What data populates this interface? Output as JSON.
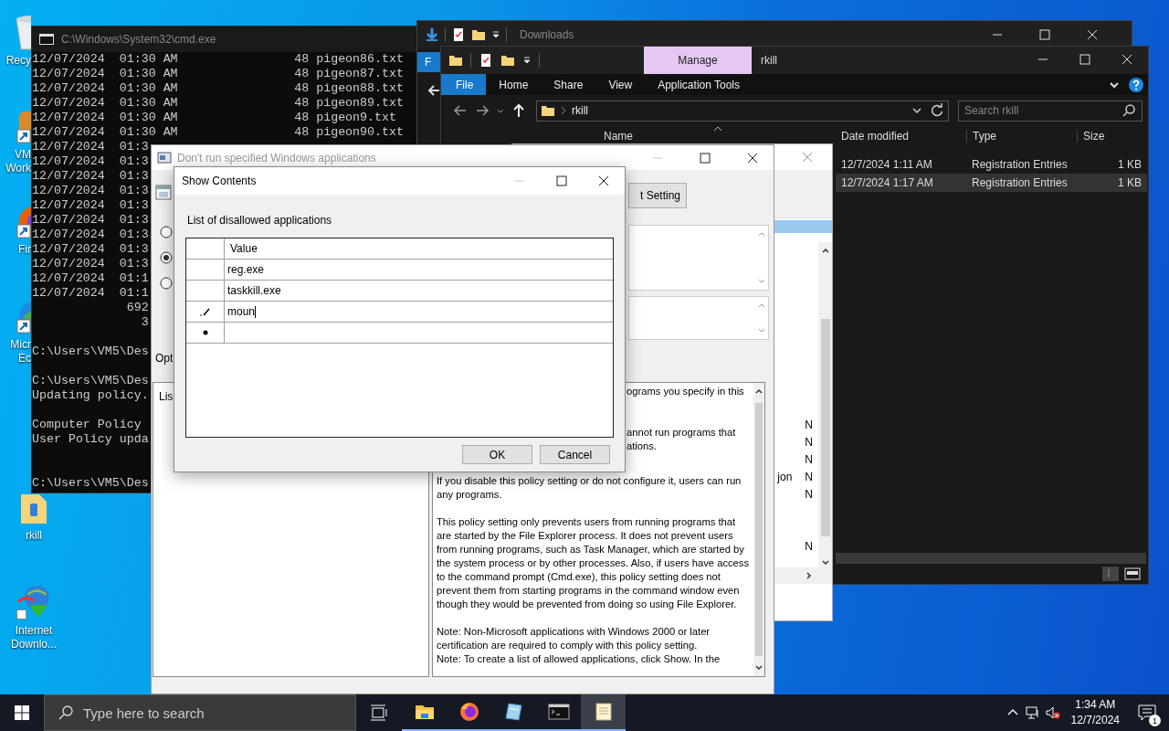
{
  "desktop": {
    "icons": [
      {
        "kind": "recycle-bin",
        "label": "Recy"
      },
      {
        "kind": "app-shortcut",
        "label": "VM Work"
      },
      {
        "kind": "firefox",
        "label": "Fir"
      },
      {
        "kind": "edge",
        "label": "Micr Ec"
      },
      {
        "kind": "folder",
        "label": "rkill"
      },
      {
        "kind": "download-manager",
        "label": "Internet Downlo..."
      }
    ]
  },
  "cmd": {
    "title": "C:\\Windows\\System32\\cmd.exe",
    "lines": [
      {
        "kind": "text",
        "text": "12/07/2024  01:30 AM                48 pigeon86.txt"
      },
      {
        "kind": "text",
        "text": "12/07/2024  01:30 AM                48 pigeon87.txt"
      },
      {
        "kind": "text",
        "text": "12/07/2024  01:30 AM                48 pigeon88.txt"
      },
      {
        "kind": "text",
        "text": "12/07/2024  01:30 AM                48 pigeon89.txt"
      },
      {
        "kind": "text",
        "text": "12/07/2024  01:30 AM                48 pigeon9.txt"
      },
      {
        "kind": "text",
        "text": "12/07/2024  01:30 AM                48 pigeon90.txt"
      },
      {
        "kind": "text",
        "text": "12/07/2024  01:3"
      },
      {
        "kind": "text",
        "text": "12/07/2024  01:3"
      },
      {
        "kind": "text",
        "text": "12/07/2024  01:3"
      },
      {
        "kind": "text",
        "text": "12/07/2024  01:3"
      },
      {
        "kind": "text",
        "text": "12/07/2024  01:3"
      },
      {
        "kind": "text",
        "text": "12/07/2024  01:3"
      },
      {
        "kind": "text",
        "text": "12/07/2024  01:3"
      },
      {
        "kind": "text",
        "text": "12/07/2024  01:3"
      },
      {
        "kind": "text",
        "text": "12/07/2024  01:3"
      },
      {
        "kind": "text",
        "text": "12/07/2024  01:1"
      },
      {
        "kind": "text",
        "text": "12/07/2024  01:1"
      },
      {
        "kind": "text",
        "text": "             692"
      },
      {
        "kind": "text",
        "text": "               3"
      },
      {
        "kind": "blank"
      },
      {
        "kind": "text",
        "text": "C:\\Users\\VM5\\Des"
      },
      {
        "kind": "blank"
      },
      {
        "kind": "text",
        "text": "C:\\Users\\VM5\\Des"
      },
      {
        "kind": "text",
        "text": "Updating policy."
      },
      {
        "kind": "blank"
      },
      {
        "kind": "text",
        "text": "Computer Policy"
      },
      {
        "kind": "text",
        "text": "User Policy upda"
      },
      {
        "kind": "blank"
      },
      {
        "kind": "blank"
      },
      {
        "kind": "text",
        "text": "C:\\Users\\VM5\\Des"
      }
    ]
  },
  "downloads_window": {
    "title": "Downloads",
    "ribbon_tab": "F"
  },
  "explorer": {
    "title": "rkill",
    "context_tab": "Manage",
    "ribbon_tabs": [
      {
        "label": "File",
        "kind": "file-menu"
      },
      {
        "label": "Home",
        "kind": "tab"
      },
      {
        "label": "Share",
        "kind": "tab"
      },
      {
        "label": "View",
        "kind": "tab"
      },
      {
        "label": "Application Tools",
        "kind": "tab"
      }
    ],
    "path": "rkill",
    "search_placeholder": "Search rkill",
    "columns": [
      "Name",
      "Date modified",
      "Type",
      "Size"
    ],
    "rows": [
      {
        "date": "12/7/2024 1:11 AM",
        "type": "Registration Entries",
        "size": "1 KB",
        "selected": false
      },
      {
        "date": "12/7/2024 1:17 AM",
        "type": "Registration Entries",
        "size": "1 KB",
        "selected": true
      }
    ]
  },
  "policy_editor": {
    "rows": [
      {
        "state": "N"
      },
      {
        "state": "N"
      },
      {
        "state": "N"
      },
      {
        "name": "jon",
        "state": "N"
      },
      {
        "state": "N"
      },
      {},
      {},
      {
        "state": "N"
      }
    ]
  },
  "policy_dialog": {
    "title": "Don't run specified Windows applications",
    "next_button": "t Setting",
    "radios": [
      {
        "selected": false
      },
      {
        "selected": true
      },
      {
        "selected": false
      }
    ],
    "options_label": "Opt",
    "options_text": "Lis",
    "help_partial": [
      {
        "kind": "text",
        "text": "ograms you specify in this"
      },
      {
        "kind": "blank"
      },
      {
        "kind": "blank"
      },
      {
        "kind": "text",
        "text": "annot run programs that"
      },
      {
        "kind": "text",
        "text": "ations."
      }
    ],
    "help": [
      "If you disable this policy setting or do not configure it, users can run any programs.",
      "This policy setting only prevents users from running programs that are started by the File Explorer process. It does not prevent users from running programs, such as Task Manager, which are started by the system process or by other processes.  Also, if users have access to the command prompt (Cmd.exe), this policy setting does not prevent them from starting programs in the command window even though they would be prevented from doing so using File Explorer.",
      "Note: Non-Microsoft applications with Windows 2000 or later certification are required to comply with this policy setting.\nNote: To create a list of allowed applications, click Show.  In the"
    ]
  },
  "show_contents": {
    "title": "Show Contents",
    "label": "List of disallowed applications",
    "column": "Value",
    "rows": [
      {
        "kind": "value",
        "value": "reg.exe"
      },
      {
        "kind": "value",
        "value": "taskkill.exe"
      },
      {
        "kind": "editing",
        "value": "moun"
      },
      {
        "kind": "new"
      }
    ],
    "buttons": [
      "OK",
      "Cancel"
    ]
  },
  "taskbar": {
    "search_placeholder": "Type here to search",
    "apps": [
      {
        "kind": "file-explorer",
        "running": true,
        "active": false
      },
      {
        "kind": "firefox",
        "running": true,
        "active": false
      },
      {
        "kind": "notebook",
        "running": true,
        "active": false
      },
      {
        "kind": "terminal",
        "running": true,
        "active": false
      },
      {
        "kind": "notepad",
        "running": true,
        "active": true
      }
    ],
    "time": "1:34 AM",
    "date": "12/7/2024",
    "notification_count": "1"
  }
}
